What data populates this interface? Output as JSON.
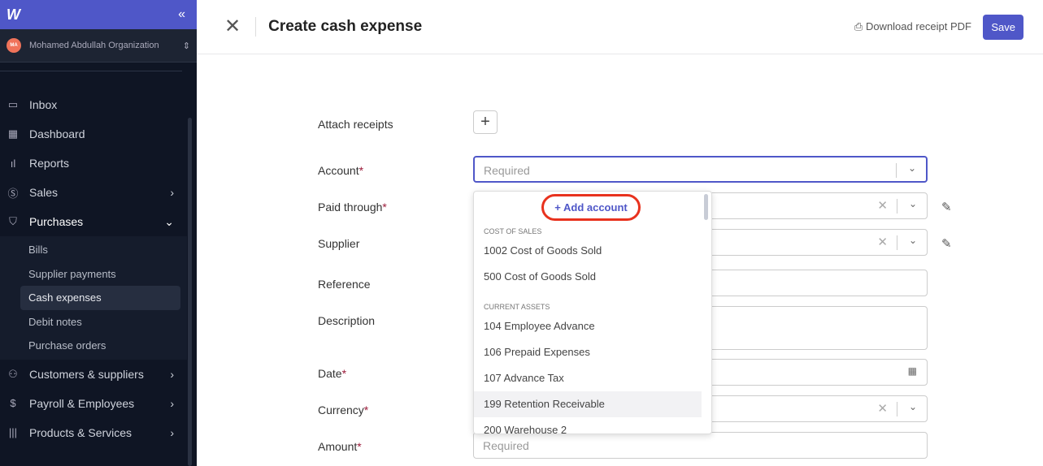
{
  "sidebar": {
    "org_name": "Mohamed Abdullah Organization",
    "avatar": "MA",
    "items": [
      {
        "label": "Inbox",
        "icon": "inbox-icon"
      },
      {
        "label": "Dashboard",
        "icon": "dashboard-icon"
      },
      {
        "label": "Reports",
        "icon": "bar-chart-icon"
      },
      {
        "label": "Sales",
        "icon": "dollar-icon"
      },
      {
        "label": "Purchases",
        "icon": "bag-icon"
      }
    ],
    "purchases_sub": [
      "Bills",
      "Supplier payments",
      "Cash expenses",
      "Debit notes",
      "Purchase orders"
    ],
    "items_after": [
      {
        "label": "Customers & suppliers",
        "icon": "users-icon"
      },
      {
        "label": "Payroll & Employees",
        "icon": "payroll-icon"
      },
      {
        "label": "Products & Services",
        "icon": "barcode-icon"
      }
    ]
  },
  "header": {
    "title": "Create cash expense",
    "download": "Download receipt PDF",
    "save": "Save"
  },
  "form": {
    "attach": "Attach receipts",
    "account": "Account",
    "paid_through": "Paid through",
    "supplier": "Supplier",
    "reference": "Reference",
    "description": "Description",
    "date": "Date",
    "currency": "Currency",
    "amount": "Amount",
    "required_placeholder": "Required",
    "required_mark": "*"
  },
  "dropdown": {
    "add": "+ Add account",
    "groups": [
      {
        "name": "COST OF SALES",
        "options": [
          "1002 Cost of Goods Sold",
          "500 Cost of Goods Sold"
        ]
      },
      {
        "name": "CURRENT ASSETS",
        "options": [
          "104 Employee Advance",
          "106 Prepaid Expenses",
          "107 Advance Tax",
          "199 Retention Receivable",
          "200 Warehouse 2"
        ]
      }
    ]
  },
  "colors": {
    "accent": "#4f57c8",
    "highlight": "#e8321e"
  }
}
